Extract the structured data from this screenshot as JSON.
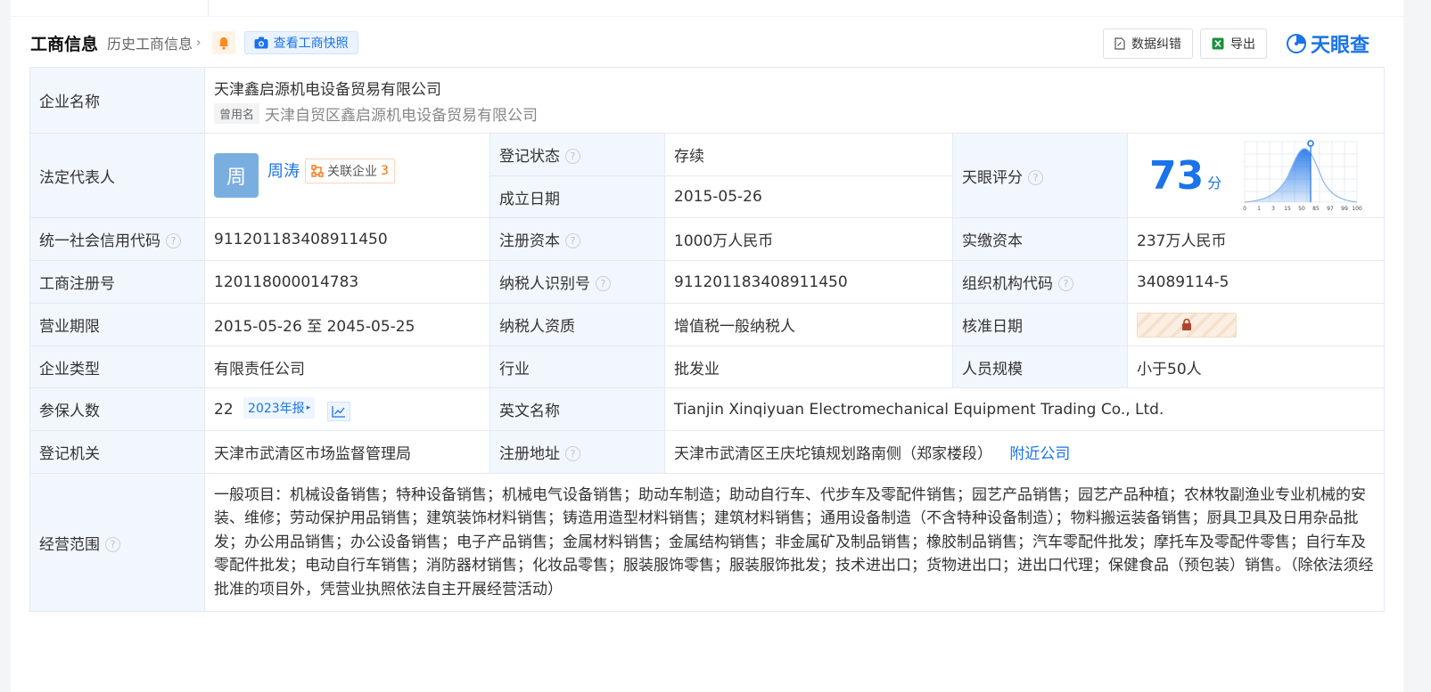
{
  "header": {
    "title": "工商信息",
    "history_link": "历史工商信息",
    "snapshot_button": "查看工商快照",
    "correction_button": "数据纠错",
    "export_button": "导出",
    "logo_text": "天眼查"
  },
  "company": {
    "name_label": "企业名称",
    "name": "天津鑫启源机电设备贸易有限公司",
    "former_tag": "曾用名",
    "former_name": "天津自贸区鑫启源机电设备贸易有限公司"
  },
  "legal_rep": {
    "label": "法定代表人",
    "avatar_char": "周",
    "name": "周涛",
    "related_label": "关联企业",
    "related_count": "3"
  },
  "status": {
    "label": "登记状态",
    "value": "存续"
  },
  "established": {
    "label": "成立日期",
    "value": "2015-05-26"
  },
  "score": {
    "label": "天眼评分",
    "value": "73",
    "unit": "分",
    "curve_ticks": [
      "0",
      "1",
      "3",
      "15",
      "50",
      "85",
      "97",
      "99",
      "100"
    ]
  },
  "rows": {
    "credit_code": {
      "label": "统一社会信用代码",
      "value": "911201183408911450"
    },
    "reg_capital": {
      "label": "注册资本",
      "value": "1000万人民币"
    },
    "paid_capital": {
      "label": "实缴资本",
      "value": "237万人民币"
    },
    "reg_number": {
      "label": "工商注册号",
      "value": "120118000014783"
    },
    "taxpayer_id": {
      "label": "纳税人识别号",
      "value": "911201183408911450"
    },
    "org_code": {
      "label": "组织机构代码",
      "value": "34089114-5"
    },
    "term": {
      "label": "营业期限",
      "value": "2015-05-26 至 2045-05-25"
    },
    "taxpayer_type": {
      "label": "纳税人资质",
      "value": "增值税一般纳税人"
    },
    "approve_date": {
      "label": "核准日期"
    },
    "company_type": {
      "label": "企业类型",
      "value": "有限责任公司"
    },
    "industry": {
      "label": "行业",
      "value": "批发业"
    },
    "staff_size": {
      "label": "人员规模",
      "value": "小于50人"
    },
    "insured": {
      "label": "参保人数",
      "value": "22",
      "report": "2023年报"
    },
    "english_name": {
      "label": "英文名称",
      "value": "Tianjin Xinqiyuan Electromechanical Equipment Trading Co., Ltd."
    },
    "authority": {
      "label": "登记机关",
      "value": "天津市武清区市场监督管理局"
    },
    "address": {
      "label": "注册地址",
      "value": "天津市武清区王庆坨镇规划路南侧（郑家楼段）",
      "nearby": "附近公司"
    },
    "scope": {
      "label": "经营范围",
      "value": "一般项目：机械设备销售；特种设备销售；机械电气设备销售；助动车制造；助动自行车、代步车及零配件销售；园艺产品销售；园艺产品种植；农林牧副渔业专业机械的安装、维修；劳动保护用品销售；建筑装饰材料销售；铸造用造型材料销售；建筑材料销售；通用设备制造（不含特种设备制造）；物料搬运装备销售；厨具卫具及日用杂品批发；办公用品销售；办公设备销售；电子产品销售；金属材料销售；金属结构销售；非金属矿及制品销售；橡胶制品销售；汽车零配件批发；摩托车及零配件零售；自行车及零配件批发；电动自行车销售；消防器材销售；化妆品零售；服装服饰零售；服装服饰批发；技术进出口；货物进出口；进出口代理；保健食品（预包装）销售。（除依法须经批准的项目外，凭营业执照依法自主开展经营活动）"
    }
  },
  "colors": {
    "accent": "#1a73e8",
    "status_green": "#2e9a3a",
    "label_bg": "#f2f7fd"
  }
}
